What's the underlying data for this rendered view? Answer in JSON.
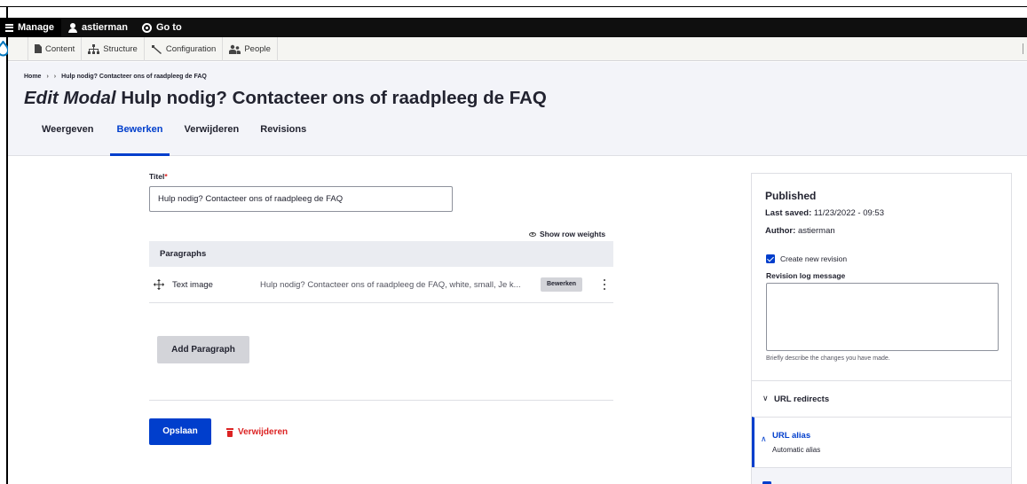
{
  "toolbar": {
    "manage_label": "Manage",
    "user_label": "astierman",
    "goto_label": "Go to"
  },
  "admin_menu": {
    "items": [
      {
        "label": "Content",
        "icon": "content-icon"
      },
      {
        "label": "Structure",
        "icon": "structure-icon"
      },
      {
        "label": "Configuration",
        "icon": "wrench-icon"
      },
      {
        "label": "People",
        "icon": "people-icon"
      }
    ]
  },
  "breadcrumb": {
    "home": "Home",
    "sep": "›",
    "current": "Hulp nodig? Contacteer ons of raadpleeg de FAQ"
  },
  "page": {
    "title_prefix": "Edit Modal",
    "title_rest": "Hulp nodig? Contacteer ons of raadpleeg de FAQ"
  },
  "tabs": [
    {
      "label": "Weergeven",
      "active": false
    },
    {
      "label": "Bewerken",
      "active": true
    },
    {
      "label": "Verwijderen",
      "active": false
    },
    {
      "label": "Revisions",
      "active": false
    }
  ],
  "form": {
    "title_label": "Titel",
    "title_required_marker": "*",
    "title_value": "Hulp nodig? Contacteer ons of raadpleeg de FAQ",
    "show_row_weights": "Show row weights",
    "paragraphs_header": "Paragraphs",
    "paragraph_rows": [
      {
        "type": "Text image",
        "summary": "Hulp nodig? Contacteer ons of raadpleeg de FAQ, white, small, Je k...",
        "edit_label": "Bewerken"
      }
    ],
    "add_paragraph": "Add Paragraph",
    "save": "Opslaan",
    "delete": "Verwijderen"
  },
  "sidebar": {
    "status": "Published",
    "last_saved_label": "Last saved:",
    "last_saved_value": "11/23/2022 - 09:53",
    "author_label": "Author:",
    "author_value": "astierman",
    "create_revision_label": "Create new revision",
    "create_revision_checked": true,
    "revision_log_label": "Revision log message",
    "revision_log_value": "",
    "revision_help": "Briefly describe the changes you have made.",
    "url_redirects_label": "URL redirects",
    "url_alias_label": "URL alias",
    "url_alias_sub": "Automatic alias"
  },
  "colors": {
    "accent": "#003ecc",
    "danger": "#dc2323",
    "toolbar_bg": "#0f0f0f",
    "header_bg": "#f3f4f9"
  }
}
